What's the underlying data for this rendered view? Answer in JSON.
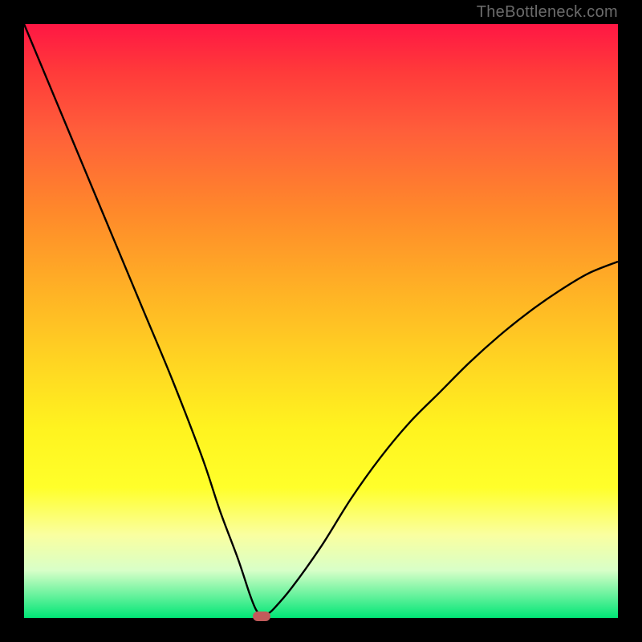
{
  "attribution": "TheBottleneck.com",
  "chart_data": {
    "type": "line",
    "title": "",
    "xlabel": "",
    "ylabel": "",
    "xlim": [
      0,
      100
    ],
    "ylim": [
      0,
      100
    ],
    "x": [
      0,
      5,
      10,
      15,
      20,
      25,
      30,
      33,
      36,
      38,
      39,
      40,
      41,
      42,
      45,
      50,
      55,
      60,
      65,
      70,
      75,
      80,
      85,
      90,
      95,
      100
    ],
    "values": [
      100,
      88,
      76,
      64,
      52,
      40,
      27,
      18,
      10,
      4,
      1.5,
      0.3,
      0.7,
      1.5,
      5,
      12,
      20,
      27,
      33,
      38,
      43,
      47.5,
      51.5,
      55,
      58,
      60
    ],
    "marker": {
      "x": 40,
      "y": 0.3
    },
    "background_gradient": {
      "top_color": "#ff1744",
      "bottom_color": "#00e676"
    }
  }
}
